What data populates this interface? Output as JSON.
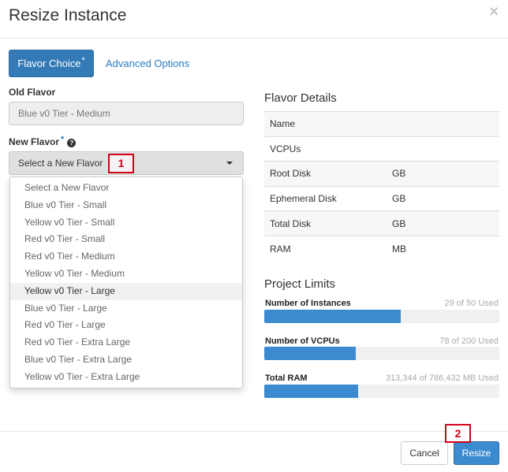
{
  "modal": {
    "title": "Resize Instance",
    "close_glyph": "×"
  },
  "tabs": [
    {
      "label": "Flavor Choice",
      "required_mark": "*",
      "active": true
    },
    {
      "label": "Advanced Options",
      "active": false
    }
  ],
  "old_flavor": {
    "label": "Old Flavor",
    "value": "Blue v0 Tier - Medium"
  },
  "new_flavor": {
    "label": "New Flavor",
    "required_mark": "*",
    "help_icon": "question-circle-icon",
    "selected": "Select a New Flavor",
    "options": [
      "Select a New Flavor",
      "Blue v0 Tier - Small",
      "Yellow v0 Tier - Small",
      "Red v0 Tier - Small",
      "Red v0 Tier - Medium",
      "Yellow v0 Tier - Medium",
      "Yellow v0 Tier - Large",
      "Blue v0 Tier - Large",
      "Red v0 Tier - Large",
      "Red v0 Tier - Extra Large",
      "Blue v0 Tier - Extra Large",
      "Yellow v0 Tier - Extra Large"
    ],
    "highlighted_option": "Yellow v0 Tier - Large"
  },
  "flavor_details": {
    "title": "Flavor Details",
    "rows": [
      {
        "name": "Name",
        "value": ""
      },
      {
        "name": "VCPUs",
        "value": ""
      },
      {
        "name": "Root Disk",
        "value": "GB"
      },
      {
        "name": "Ephemeral Disk",
        "value": "GB"
      },
      {
        "name": "Total Disk",
        "value": "GB"
      },
      {
        "name": "RAM",
        "value": "MB"
      }
    ]
  },
  "project_limits": {
    "title": "Project Limits",
    "items": [
      {
        "label": "Number of Instances",
        "used_text": "29 of 50 Used",
        "used": 29,
        "total": 50
      },
      {
        "label": "Number of VCPUs",
        "used_text": "78 of 200 Used",
        "used": 78,
        "total": 200
      },
      {
        "label": "Total RAM",
        "used_text": "313,344 of 786,432 MB Used",
        "used": 313344,
        "total": 786432
      }
    ]
  },
  "annotations": {
    "callout_1": "1",
    "callout_2": "2"
  },
  "footer": {
    "cancel_label": "Cancel",
    "resize_label": "Resize"
  },
  "colors": {
    "primary": "#337ab7",
    "bar_fill": "#3c8bd0",
    "callout": "#d0021b",
    "link": "#2a7bbf"
  }
}
